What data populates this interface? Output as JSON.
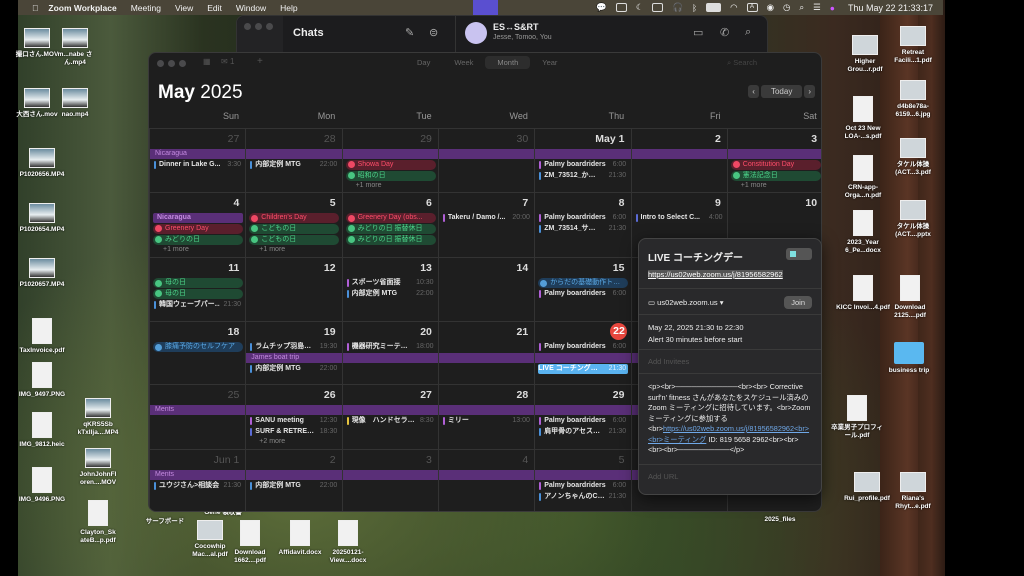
{
  "menubar": {
    "app_name": "Zoom Workplace",
    "menus": [
      "Meeting",
      "View",
      "Edit",
      "Window",
      "Help"
    ],
    "status_icons": [
      "zoom-share-icon",
      "chat-bubble-icon",
      "window-icon",
      "moon-icon",
      "display-icon",
      "headphones-icon",
      "bluetooth-icon",
      "battery-icon",
      "wifi-icon",
      "input-A-icon",
      "user-icon",
      "clock-icon",
      "search-icon",
      "control-center-icon",
      "siri-icon"
    ],
    "input_label": "A",
    "clock": "Thu May 22  21:33:17"
  },
  "chat": {
    "title": "Chats",
    "conversation_name": "ES↔S&RT",
    "members": "Jesse, Tomoo, You"
  },
  "calendar": {
    "inbox_count": "1",
    "views": [
      "Day",
      "Week",
      "Month",
      "Year"
    ],
    "active_view": "Month",
    "search_placeholder": "Search",
    "month": "May",
    "year": "2025",
    "today_label": "Today",
    "weekdays": [
      "Sun",
      "Mon",
      "Tue",
      "Wed",
      "Thu",
      "Fri",
      "Sat"
    ],
    "weeks": [
      {
        "spans": [
          {
            "title": "Nicaragua",
            "from": 0,
            "to": 6
          }
        ],
        "days": [
          {
            "num": "27",
            "other": true,
            "events": [
              {
                "title": "Dinner in Lake G...",
                "time": "3:30",
                "color": "#4a90d9"
              }
            ]
          },
          {
            "num": "28",
            "other": true,
            "events": [
              {
                "title": "内部定例 MTG",
                "time": "22:00",
                "color": "#4a90d9"
              }
            ]
          },
          {
            "num": "29",
            "other": true,
            "events": [
              {
                "title": "Showa Day",
                "kind": "red"
              },
              {
                "title": "昭和の日",
                "kind": "green"
              },
              {
                "title": "+1 more",
                "kind": "more"
              }
            ]
          },
          {
            "num": "30",
            "other": true,
            "events": []
          },
          {
            "num": "May 1",
            "events": [
              {
                "title": "Palmy boardriders",
                "time": "6:00",
                "color": "#b05fd6"
              },
              {
                "title": "ZM_73512_か…",
                "time": "21:30",
                "color": "#4a90d9"
              }
            ]
          },
          {
            "num": "2",
            "events": []
          },
          {
            "num": "3",
            "events": [
              {
                "title": "Constitution Day",
                "kind": "red"
              },
              {
                "title": "憲法記念日",
                "kind": "green"
              },
              {
                "title": "+1 more",
                "kind": "more"
              }
            ]
          }
        ]
      },
      {
        "spans": [],
        "days": [
          {
            "num": "4",
            "events": [
              {
                "title": "Nicaragua",
                "kind": "purple"
              },
              {
                "title": "Greenery Day",
                "kind": "red"
              },
              {
                "title": "みどりの日",
                "kind": "green"
              },
              {
                "title": "+1 more",
                "kind": "more"
              }
            ]
          },
          {
            "num": "5",
            "events": [
              {
                "title": "Children's Day",
                "kind": "red"
              },
              {
                "title": "こどもの日",
                "kind": "green"
              },
              {
                "title": "こどもの日",
                "kind": "green"
              },
              {
                "title": "+1 more",
                "kind": "more"
              }
            ]
          },
          {
            "num": "6",
            "events": [
              {
                "title": "Greenery Day (obs...",
                "kind": "red"
              },
              {
                "title": "みどりの日 振替休日",
                "kind": "green"
              },
              {
                "title": "みどりの日 振替休日",
                "kind": "green"
              }
            ]
          },
          {
            "num": "7",
            "events": [
              {
                "title": "Takeru / Damo /...",
                "time": "20:00",
                "color": "#b05fd6"
              }
            ]
          },
          {
            "num": "8",
            "events": [
              {
                "title": "Palmy boardriders",
                "time": "6:00",
                "color": "#b05fd6"
              },
              {
                "title": "ZM_73514_サ…",
                "time": "21:30",
                "color": "#4a90d9"
              }
            ]
          },
          {
            "num": "9",
            "events": [
              {
                "title": "Intro to Select C...",
                "time": "4:00",
                "color": "#5b6bd6"
              }
            ]
          },
          {
            "num": "10",
            "events": []
          }
        ]
      },
      {
        "spans": [],
        "days": [
          {
            "num": "11",
            "events": [
              {
                "title": "母の日",
                "kind": "green"
              },
              {
                "title": "母の日",
                "kind": "green"
              },
              {
                "title": "韓国ウェーブパー…",
                "time": "21:30",
                "color": "#4a90d9"
              }
            ]
          },
          {
            "num": "12",
            "events": []
          },
          {
            "num": "13",
            "events": [
              {
                "title": "スポーツ省面接",
                "time": "10:30",
                "color": "#b05fd6"
              },
              {
                "title": "内部定例 MTG",
                "time": "22:00",
                "color": "#4a90d9"
              }
            ]
          },
          {
            "num": "14",
            "events": []
          },
          {
            "num": "15",
            "events": [
              {
                "title": "からだの基礎動作ト…",
                "kind": "blue"
              },
              {
                "title": "Palmy boardriders",
                "time": "6:00",
                "color": "#b05fd6"
              }
            ]
          },
          {
            "num": "",
            "events": []
          },
          {
            "num": "",
            "events": []
          }
        ]
      },
      {
        "spans": [
          {
            "title": "James boat trip",
            "from": 1,
            "to": 6
          }
        ],
        "days": [
          {
            "num": "18",
            "events": [
              {
                "title": "膝痛予防のセルフケア",
                "kind": "blue"
              }
            ]
          },
          {
            "num": "19",
            "events": [
              {
                "title": "ラムチップ羽島…",
                "time": "19:30",
                "color": "#4a90d9"
              },
              {
                "title": "内部定例 MTG",
                "time": "22:00",
                "color": "#4a90d9"
              }
            ]
          },
          {
            "num": "20",
            "events": [
              {
                "title": "機器研究ミーテ…",
                "time": "18:00",
                "color": "#b05fd6"
              }
            ]
          },
          {
            "num": "21",
            "events": []
          },
          {
            "num": "22",
            "today": true,
            "events": [
              {
                "title": "Palmy boardriders",
                "time": "6:00",
                "color": "#b05fd6"
              },
              {
                "title": "LIVE コーチング…",
                "time": "21:30",
                "kind": "sel"
              }
            ]
          },
          {
            "num": "",
            "events": []
          },
          {
            "num": "",
            "events": []
          }
        ]
      },
      {
        "spans": [
          {
            "title": "Ments",
            "from": 0,
            "to": 6
          }
        ],
        "days": [
          {
            "num": "25",
            "other": true,
            "events": []
          },
          {
            "num": "26",
            "events": [
              {
                "title": "SANU meeting",
                "time": "12:30",
                "color": "#b05fd6"
              },
              {
                "title": "SURF & RETRE…",
                "time": "18:30",
                "color": "#5b6bd6"
              },
              {
                "title": "+2 more",
                "kind": "more"
              }
            ]
          },
          {
            "num": "27",
            "events": [
              {
                "title": "現像　ハンドセラ…",
                "time": "8:30",
                "color": "#e6c440"
              }
            ]
          },
          {
            "num": "28",
            "events": [
              {
                "title": "ミリー",
                "time": "13:00",
                "color": "#b05fd6"
              }
            ]
          },
          {
            "num": "29",
            "events": [
              {
                "title": "Palmy boardriders",
                "time": "6:00",
                "color": "#b05fd6"
              },
              {
                "title": "肩甲骨のアセス…",
                "time": "21:30",
                "color": "#4a90d9"
              }
            ]
          },
          {
            "num": "",
            "events": []
          },
          {
            "num": "",
            "events": []
          }
        ]
      },
      {
        "spans": [
          {
            "title": "Ments",
            "from": 0,
            "to": 6
          }
        ],
        "days": [
          {
            "num": "Jun 1",
            "other": true,
            "events": [
              {
                "title": "ユウジさん>相談会",
                "time": "21:30",
                "color": "#4a90d9"
              }
            ]
          },
          {
            "num": "2",
            "other": true,
            "events": [
              {
                "title": "内部定例 MTG",
                "time": "22:00",
                "color": "#4a90d9"
              }
            ]
          },
          {
            "num": "3",
            "other": true,
            "events": []
          },
          {
            "num": "4",
            "other": true,
            "events": []
          },
          {
            "num": "5",
            "other": true,
            "events": [
              {
                "title": "Palmy boardriders",
                "time": "6:00",
                "color": "#b05fd6"
              },
              {
                "title": "アノンちゃんのC…",
                "time": "21:30",
                "color": "#4a90d9"
              }
            ]
          },
          {
            "num": "",
            "events": []
          },
          {
            "num": "",
            "events": []
          }
        ]
      }
    ]
  },
  "event_popover": {
    "title": "LIVE コーチングデー",
    "url": "https://us02web.zoom.us/j/81956582962",
    "location": "us02web.zoom.us",
    "join_label": "Join",
    "datetime": "May 22, 2025  21:30 to 22:30",
    "alert": "Alert 30 minutes before start",
    "invitees_placeholder": "Add Invitees",
    "notes_before": "<p><br>────────────<br><br> Corrective surf'n' fitness さんがあなたをスケジュール済みの Zoom ミーティングに招待しています。<br>Zoom ミーティングに参加する<br>",
    "notes_link": "https://us02web.zoom.us/j/81956582962<br><br>ミーティング",
    "notes_after": " ID: 819 5658 2962<br><br><br><br>──────────</p>",
    "url_placeholder": "Add URL"
  },
  "desktop_icons": [
    "撮口さん.MOV",
    "m...nabe さん.mp4",
    "大西さん.mov",
    "nao.mp4",
    "P1020656.MP4",
    "P1020654.MP4",
    "P1020657.MP4",
    "TaxInvoice.pdf",
    "IMG_9497.PNG",
    "IMG_9812.heic",
    "IMG_9496.PNG",
    "qKRS5Sb kTxIlja....MP4",
    "JohnJohnFl oren....MOV",
    "Clayton_Sk ateB...p.pdf",
    "Higher Grou...r.pdf",
    "Retreat Facili...1.pdf",
    "d4b8e78a-6159...6.jpg",
    "Oct 23 New LOA-...s.pdf",
    "タケル体操 (ACT...3.pdf",
    "CRN-app-Orga...n.pdf",
    "2023_Year 6_Pe...docx",
    "タケル体操 (ACT....pptx",
    "KICC Invoi...4.pdf",
    "Download 2125....pdf",
    "business trip",
    "卒業男子プロフィール.pdf",
    "Rui_profile.pdf",
    "Riana's Rhyt...e.pdf",
    "サーフボード",
    "Gene 領収書",
    "Cocowhip Mac...al.pdf",
    "Download 1662....pdf",
    "Affidavit.docx",
    "20250121-View....docx",
    "2025_files"
  ]
}
